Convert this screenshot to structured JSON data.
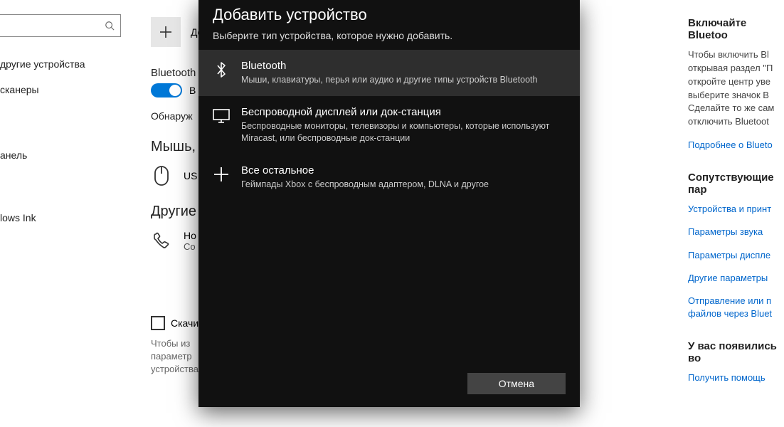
{
  "search": {
    "placeholder": ""
  },
  "nav": {
    "items": [
      "другие устройства",
      "сканеры",
      "анель",
      "lows Ink"
    ]
  },
  "main": {
    "add_label": "До",
    "bt_label": "Bluetooth",
    "toggle_on": "В",
    "detect": "Обнаруж",
    "mouse_head": "Мышь,",
    "mouse_item": "US",
    "other_head": "Другие",
    "other_item1": "Но",
    "other_item2": "Со",
    "meter_check": "Скачи",
    "meter_desc": "Чтобы из\nпараметр\nустройства не будут скачиваться через лимитные подключения к"
  },
  "right": {
    "h1": "Включайте Bluetoo",
    "body1": "Чтобы включить Bl\nоткрывая раздел \"П\nоткройте центр уве\nвыберите значок B\nСделайте то же сам\nотключить Bluetoot",
    "link1": "Подробнее о Blueto",
    "h2": "Сопутствующие пар",
    "links2": [
      "Устройства и принт",
      "Параметры звука",
      "Параметры диспле",
      "Другие параметры",
      "Отправление или п\nфайлов через Bluet"
    ],
    "h3": "У вас появились во",
    "link3": "Получить помощь"
  },
  "modal": {
    "title": "Добавить устройство",
    "subtitle": "Выберите тип устройства, которое нужно добавить.",
    "options": [
      {
        "title": "Bluetooth",
        "desc": "Мыши, клавиатуры, перья или аудио и другие типы устройств Bluetooth"
      },
      {
        "title": "Беспроводной дисплей или док-станция",
        "desc": "Беспроводные мониторы, телевизоры и компьютеры, которые используют Miracast, или беспроводные док-станции"
      },
      {
        "title": "Все остальное",
        "desc": "Геймпады Xbox с беспроводным адаптером, DLNA и другое"
      }
    ],
    "cancel": "Отмена"
  }
}
